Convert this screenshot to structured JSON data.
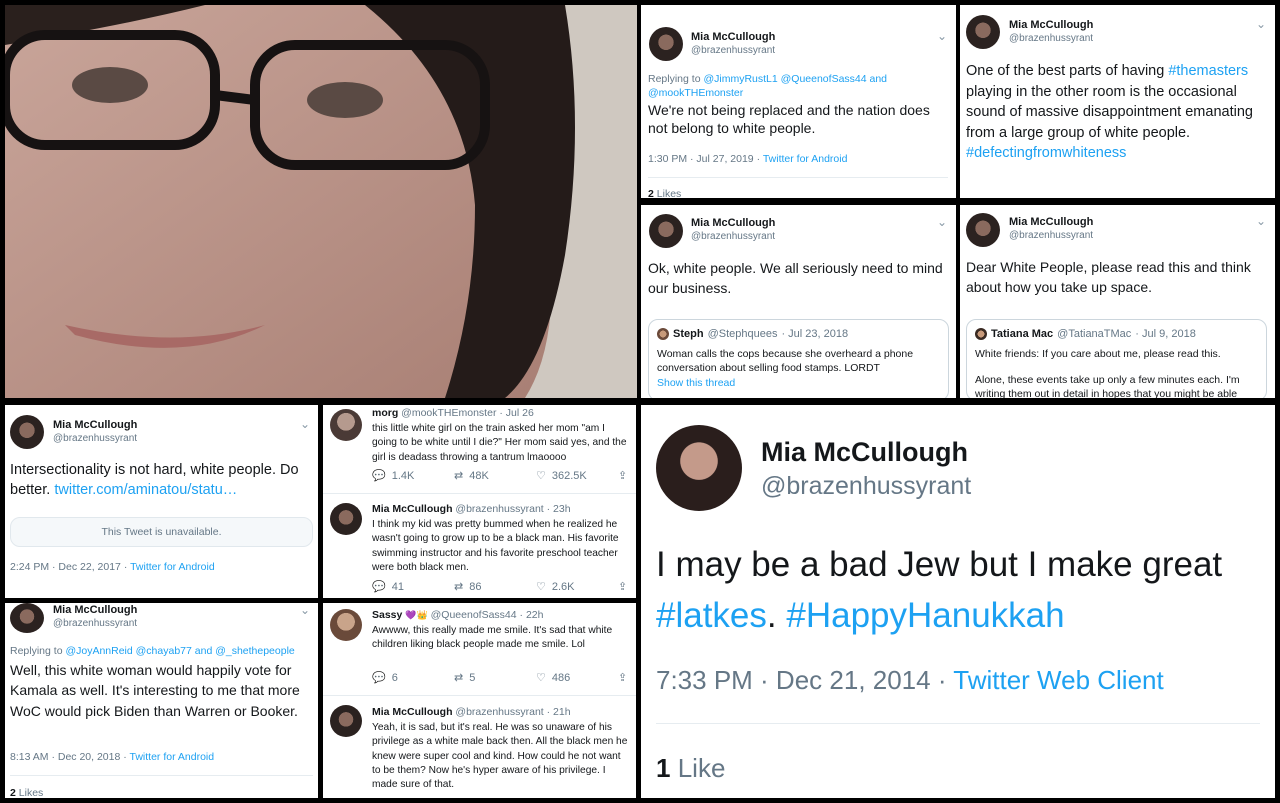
{
  "profile": {
    "name": "Mia McCullough",
    "handle": "@brazenhussyrant"
  },
  "tweet1": {
    "replying_prefix": "Replying to ",
    "replying_to": "@JimmyRustL1 @QueenofSass44 and @mookTHEmonster",
    "text": "We're not being replaced and the nation does not belong to white people.",
    "time": "1:30 PM · Jul 27, 2019",
    "client": "Twitter for Android",
    "likes_count": "2",
    "likes_label": "Likes"
  },
  "tweet2": {
    "text_1": "One of the best parts of having ",
    "hashtag_1": "#themasters",
    "text_2": " playing in the other room is the occasional sound of massive disappointment emanating from a large group of white people.",
    "hashtag_2": "#defectingfromwhiteness"
  },
  "tweet3": {
    "text": "Ok, white people. We all seriously need to mind our business.",
    "quote": {
      "name": "Steph",
      "handle": "@Stephquees",
      "date": "· Jul 23, 2018",
      "text": "Woman calls the cops because she overheard a phone conversation about selling food stamps. LORDT",
      "show_thread": "Show this thread"
    }
  },
  "tweet4": {
    "text": "Dear White People, please read this and think about how you take up space.",
    "quote": {
      "name": "Tatiana Mac",
      "handle": "@TatianaTMac",
      "date": "· Jul 9, 2018",
      "text_1": "White friends: If you care about me, please read this.",
      "text_2": "Alone, these events take up only a few minutes each. I'm writing them out in detail in hopes that you might be able"
    }
  },
  "tweet5": {
    "text": "Intersectionality is not hard, white people. Do better. ",
    "link": "twitter.com/aminatou/statu…",
    "unavailable": "This Tweet is unavailable.",
    "time": "2:24 PM · Dec 22, 2017",
    "client": "Twitter for Android"
  },
  "thread1": {
    "morg": {
      "name": "morg",
      "handle": "@mookTHEmonster",
      "date": "· Jul 26",
      "text": "this little white girl on the train asked her mom \"am I going to be white until I die?\" Her mom said yes, and the girl is deadass throwing a tantrum lmaoooo",
      "replies": "1.4K",
      "retweets": "48K",
      "likes": "362.5K"
    },
    "mia": {
      "handle_time": "@brazenhussyrant · 23h",
      "text": "I think my kid was pretty bummed when he realized he wasn't going to grow up to be a black man. His favorite swimming instructor and his favorite preschool teacher were both black men.",
      "replies": "41",
      "retweets": "86",
      "likes": "2.6K"
    }
  },
  "tweet6": {
    "replying_prefix": "Replying to ",
    "replying_to": "@JoyAnnReid @chayab77 and @_shethepeople",
    "text": "Well, this white woman would happily vote for Kamala as well. It's interesting to me that more WoC would pick Biden than Warren or Booker.",
    "time": "8:13 AM · Dec 20, 2018",
    "client": "Twitter for Android",
    "likes_count": "2",
    "likes_label": "Likes"
  },
  "thread2": {
    "sassy": {
      "name": "Sassy",
      "emoji": "💜👑",
      "handle": "@QueenofSass44",
      "date": "· 22h",
      "text": "Awwww, this really made me smile. It's sad that white children liking black people made me smile. Lol",
      "replies": "6",
      "retweets": "5",
      "likes": "486"
    },
    "mia": {
      "handle_time": "@brazenhussyrant · 21h",
      "text": "Yeah, it is sad, but it's real. He was so unaware of his privilege as a white male back then. All the black men he knew were super cool and kind. How could he not want to be them? Now he's hyper aware of his privilege. I made sure of that."
    }
  },
  "tweet7": {
    "text": "I may be a bad Jew but I make great ",
    "hashtag_1": "#latkes",
    "sep": ". ",
    "hashtag_2": "#HappyHanukkah",
    "time": "7:33 PM · Dec 21, 2014 · ",
    "client": "Twitter Web Client",
    "likes_count": "1",
    "likes_label": "Like"
  },
  "icons": {
    "reply": "reply-icon",
    "retweet": "retweet-icon",
    "like": "heart-icon",
    "share": "share-icon",
    "chevron": "chevron-down-icon"
  },
  "colors": {
    "link": "#1da1f2",
    "meta": "#657786",
    "text": "#14171a"
  }
}
